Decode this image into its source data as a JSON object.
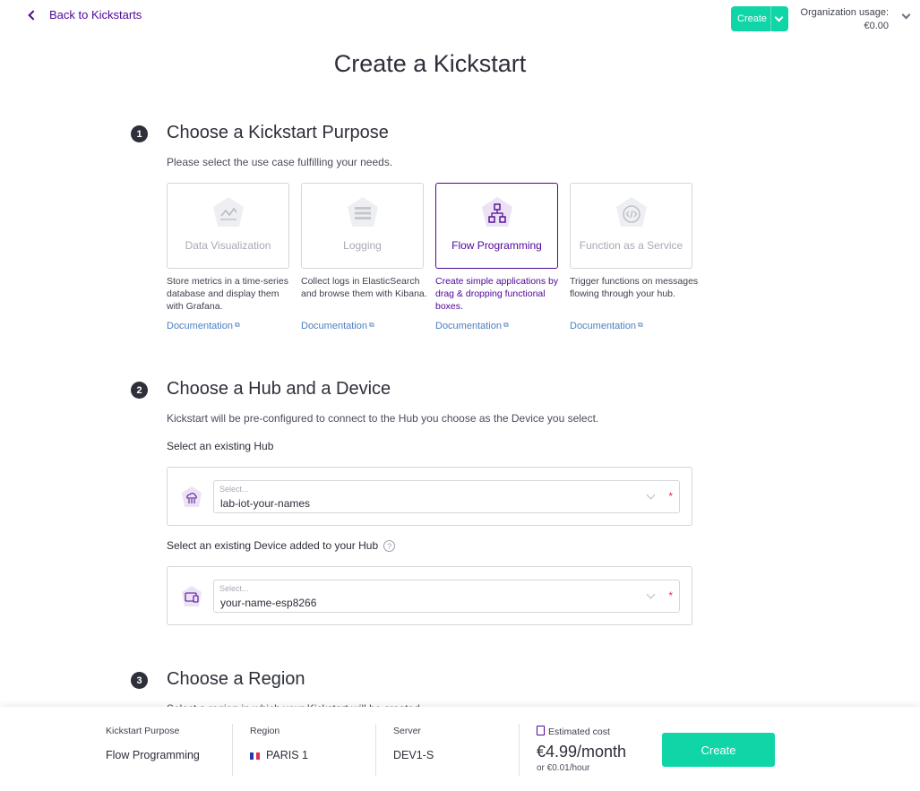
{
  "header": {
    "back_label": "Back to Kickstarts",
    "create_label": "Create",
    "org_usage_label": "Organization usage:",
    "org_usage_value": "€0.00"
  },
  "page": {
    "title": "Create a Kickstart"
  },
  "step1": {
    "number": "1",
    "title": "Choose a Kickstart Purpose",
    "description": "Please select the use case fulfilling your needs.",
    "selected": "Flow Programming",
    "cards": [
      {
        "label": "Data Visualization",
        "icon": "chart-line-icon",
        "description": "Store metrics in a time-series database and display them with Grafana.",
        "doc": "Documentation"
      },
      {
        "label": "Logging",
        "icon": "log-list-icon",
        "description": "Collect logs in ElasticSearch and browse them with Kibana.",
        "doc": "Documentation"
      },
      {
        "label": "Flow Programming",
        "icon": "flow-diagram-icon",
        "description": "Create simple applications by drag & dropping functional boxes.",
        "doc": "Documentation"
      },
      {
        "label": "Function as a Service",
        "icon": "code-icon",
        "description": "Trigger functions on messages flowing through your hub.",
        "doc": "Documentation"
      }
    ]
  },
  "step2": {
    "number": "2",
    "title": "Choose a Hub and a Device",
    "description": "Kickstart will be pre-configured to connect to the Hub you choose as the Device you select.",
    "hub": {
      "label": "Select an existing Hub",
      "placeholder": "Select...",
      "value": "lab-iot-your-names",
      "required": "*",
      "icon": "hub-cloud-icon"
    },
    "device": {
      "label": "Select an existing Device added to your Hub",
      "help": "?",
      "placeholder": "Select...",
      "value": "your-name-esp8266",
      "required": "*",
      "icon": "device-icon"
    }
  },
  "step3": {
    "number": "3",
    "title": "Choose a Region",
    "description": "Select a region in which your Kickstart will be created."
  },
  "summary": {
    "purpose_label": "Kickstart Purpose",
    "purpose_value": "Flow Programming",
    "region_label": "Region",
    "region_value": "PARIS 1",
    "server_label": "Server",
    "server_value": "DEV1-S",
    "cost_label": "Estimated cost",
    "cost_value": "€4.99/month",
    "cost_hourly": "or €0.01/hour",
    "create_label": "Create"
  },
  "colors": {
    "accent": "#4f0599",
    "primary_button": "#10d5a6",
    "link": "#4a7fc0",
    "required": "#e0314a"
  }
}
